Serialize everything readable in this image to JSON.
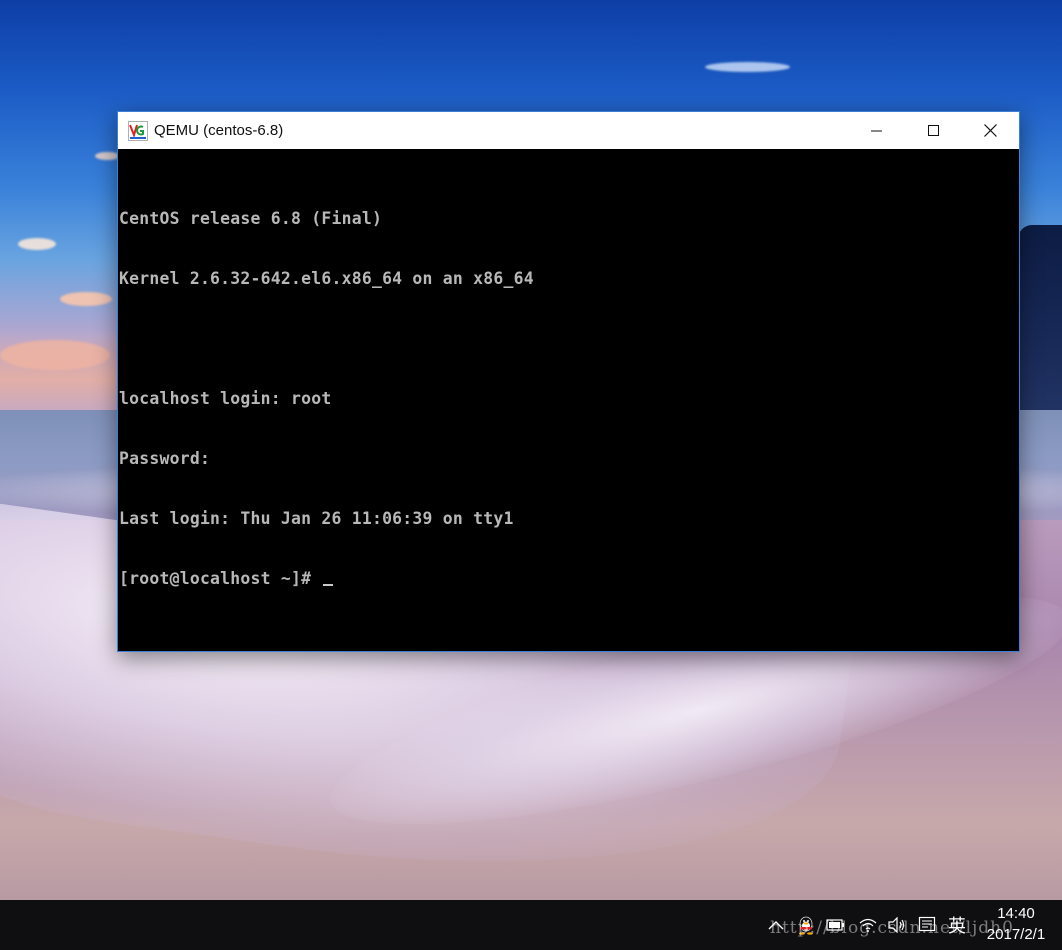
{
  "window": {
    "title": "QEMU (centos-6.8)",
    "controls": {
      "minimize": "minimize",
      "maximize": "maximize",
      "close": "close"
    }
  },
  "terminal": {
    "lines": [
      "CentOS release 6.8 (Final)",
      "Kernel 2.6.32-642.el6.x86_64 on an x86_64",
      "",
      "localhost login: root",
      "Password:",
      "Last login: Thu Jan 26 11:06:39 on tty1",
      "[root@localhost ~]# "
    ]
  },
  "taskbar": {
    "ime_label": "英",
    "clock": {
      "time": "14:40",
      "date": "2017/2/1"
    }
  },
  "watermark": "http://blog.csdn.net/ljdh0",
  "colors": {
    "terminal_bg": "#000000",
    "terminal_fg": "#b8b8b8",
    "window_border": "#3b7fd6",
    "taskbar_bg": "#0f0f12"
  }
}
